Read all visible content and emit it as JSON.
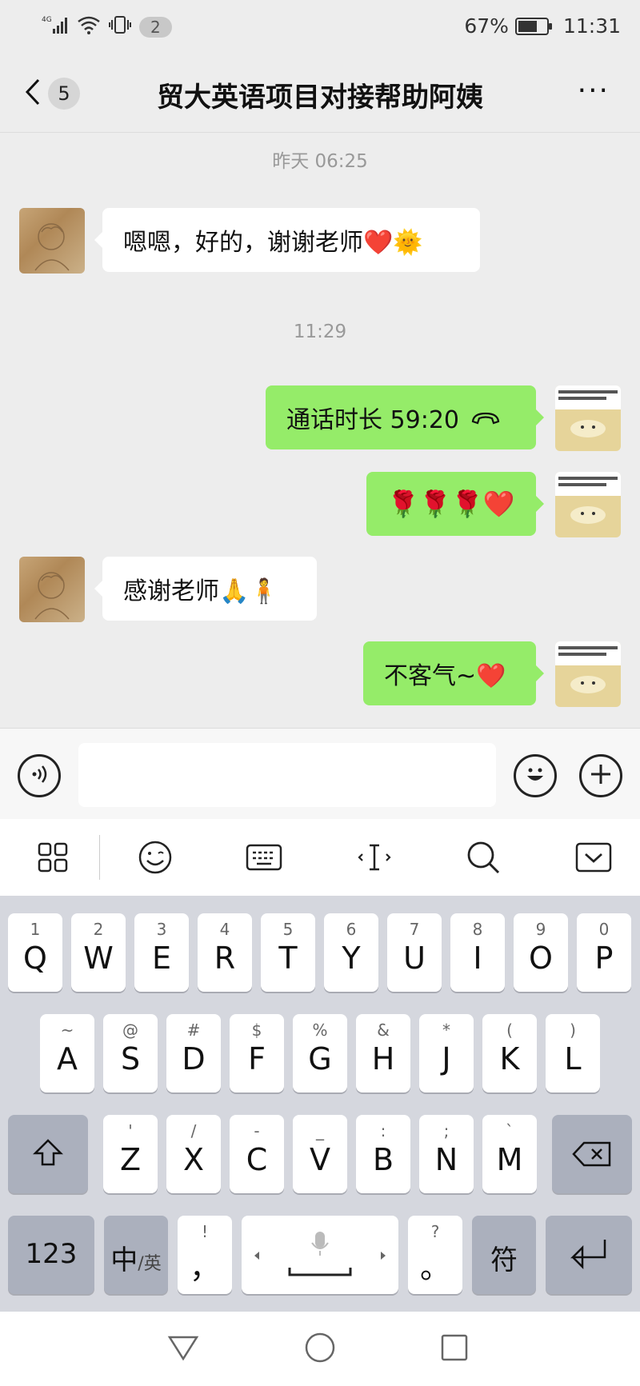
{
  "status_bar": {
    "network": "4G",
    "notification_count": "2",
    "battery": "67%",
    "battery_level": 0.67,
    "time": "11:31"
  },
  "header": {
    "back_count": "5",
    "title": "贸大英语项目对接帮助阿姨",
    "more": "···"
  },
  "chat": {
    "timestamps": [
      "昨天 06:25",
      "11:29"
    ],
    "messages": [
      {
        "side": "left",
        "text": "嗯嗯，好的，谢谢老师❤️🌞"
      },
      {
        "side": "right",
        "text": "通话时长 59:20",
        "icon": "phone-hangup-icon"
      },
      {
        "side": "right",
        "text": "🌹🌹🌹❤️"
      },
      {
        "side": "left",
        "text": "感谢老师🙏🧍"
      },
      {
        "side": "right",
        "text": "不客气~❤️"
      }
    ]
  },
  "input": {
    "value": "",
    "placeholder": ""
  },
  "keyboard_toolbar": [
    "apps-grid-icon",
    "emoji-icon",
    "keyboard-icon",
    "cursor-icon",
    "search-icon",
    "collapse-icon"
  ],
  "keyboard": {
    "row1": [
      {
        "hint": "1",
        "key": "Q"
      },
      {
        "hint": "2",
        "key": "W"
      },
      {
        "hint": "3",
        "key": "E"
      },
      {
        "hint": "4",
        "key": "R"
      },
      {
        "hint": "5",
        "key": "T"
      },
      {
        "hint": "6",
        "key": "Y"
      },
      {
        "hint": "7",
        "key": "U"
      },
      {
        "hint": "8",
        "key": "I"
      },
      {
        "hint": "9",
        "key": "O"
      },
      {
        "hint": "0",
        "key": "P"
      }
    ],
    "row2": [
      {
        "hint": "~",
        "key": "A"
      },
      {
        "hint": "@",
        "key": "S"
      },
      {
        "hint": "#",
        "key": "D"
      },
      {
        "hint": "$",
        "key": "F"
      },
      {
        "hint": "%",
        "key": "G"
      },
      {
        "hint": "&",
        "key": "H"
      },
      {
        "hint": "*",
        "key": "J"
      },
      {
        "hint": "(",
        "key": "K"
      },
      {
        "hint": ")",
        "key": "L"
      }
    ],
    "row3": [
      {
        "hint": "'",
        "key": "Z"
      },
      {
        "hint": "/",
        "key": "X"
      },
      {
        "hint": "-",
        "key": "C"
      },
      {
        "hint": "_",
        "key": "V"
      },
      {
        "hint": ":",
        "key": "B"
      },
      {
        "hint": ";",
        "key": "N"
      },
      {
        "hint": "`",
        "key": "M"
      }
    ],
    "numbers_key": "123",
    "lang_key_main": "中",
    "lang_key_sub": "/英",
    "comma_hint": "!",
    "comma_key": "，",
    "period_hint": "?",
    "period_key": "。",
    "symbols_key": "符"
  },
  "colors": {
    "bubble_self": "#95ec69",
    "bubble_other": "#ffffff",
    "background": "#ededed",
    "keyboard_bg": "#d5d7de"
  }
}
